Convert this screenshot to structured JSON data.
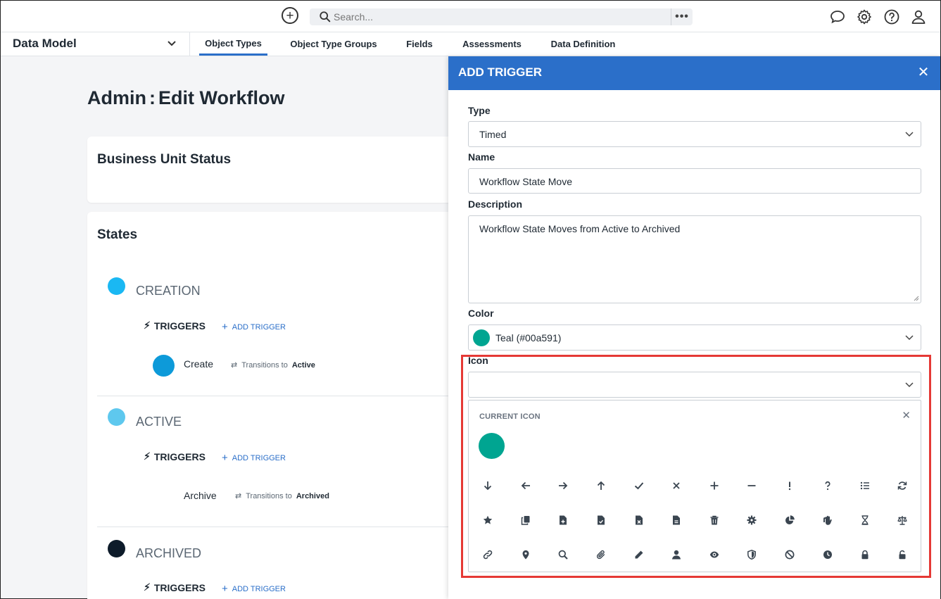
{
  "topbar": {
    "search_placeholder": "Search...",
    "more": "•••"
  },
  "nav": {
    "module": "Data Model",
    "tabs": [
      {
        "label": "Object Types",
        "active": true
      },
      {
        "label": "Object Type Groups",
        "active": false
      },
      {
        "label": "Fields",
        "active": false
      },
      {
        "label": "Assessments",
        "active": false
      },
      {
        "label": "Data Definition",
        "active": false
      }
    ]
  },
  "page": {
    "title_prefix": "Admin",
    "title_sep": ":",
    "title": "Edit Workflow",
    "workflow_name": "Business Unit Status",
    "states_heading": "States",
    "triggers_label": "TRIGGERS",
    "add_trigger_label": "ADD TRIGGER",
    "transitions_to": "Transitions to",
    "states": [
      {
        "name": "CREATION",
        "color": "#1ab8f3",
        "triggers": [
          {
            "name": "Create",
            "color": "#0d9ad9",
            "target": "Active"
          }
        ]
      },
      {
        "name": "ACTIVE",
        "color": "#5ec8ee",
        "triggers": [
          {
            "name": "Archive",
            "color": "",
            "target": "Archived"
          }
        ]
      },
      {
        "name": "ARCHIVED",
        "color": "#0d1b2a",
        "triggers": []
      }
    ]
  },
  "drawer": {
    "title": "ADD TRIGGER",
    "type_label": "Type",
    "type_value": "Timed",
    "name_label": "Name",
    "name_value": "Workflow State Move",
    "description_label": "Description",
    "description_value": "Workflow State Moves from Active to Archived",
    "color_label": "Color",
    "color_value": "Teal (#00a591)",
    "color_hex": "#00a591",
    "icon_label": "Icon",
    "icon_value": "",
    "current_icon_label": "CURRENT ICON",
    "icons": [
      "arrow-down-icon",
      "arrow-left-icon",
      "arrow-right-icon",
      "arrow-up-icon",
      "check-icon",
      "times-icon",
      "plus-icon",
      "minus-icon",
      "exclamation-icon",
      "question-icon",
      "list-icon",
      "refresh-icon",
      "star-icon",
      "copy-icon",
      "file-plus-icon",
      "file-check-icon",
      "file-times-icon",
      "file-text-icon",
      "trash-icon",
      "cog-icon",
      "pie-chart-icon",
      "hand-icon",
      "hourglass-icon",
      "scale-icon",
      "link-icon",
      "map-marker-icon",
      "search-icon",
      "paperclip-icon",
      "pencil-icon",
      "user-icon",
      "eye-icon",
      "shield-icon",
      "ban-icon",
      "clock-icon",
      "lock-icon",
      "unlock-icon"
    ]
  }
}
